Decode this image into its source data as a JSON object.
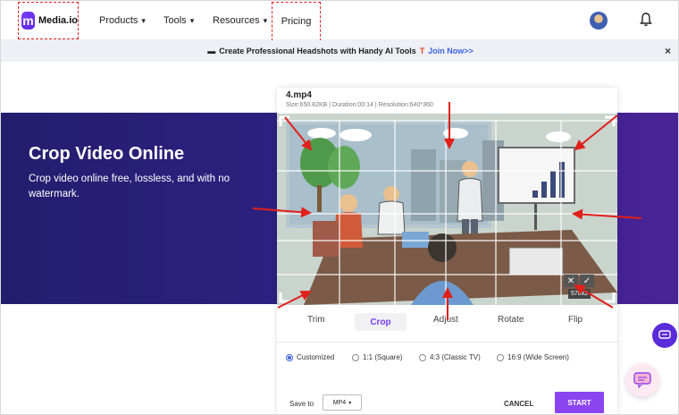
{
  "header": {
    "logo_letter": "m",
    "logo_text": "Media.io",
    "nav": {
      "products": "Products",
      "tools": "Tools",
      "resources": "Resources",
      "pricing": "Pricing"
    }
  },
  "promo": {
    "text": "Create Professional Headshots with Handy AI Tools",
    "join": "Join Now>>",
    "close": "×"
  },
  "hero": {
    "title": "Crop Video Online",
    "subtitle": "Crop video online free, lossless, and with no watermark."
  },
  "editor": {
    "file_name": "4.mp4",
    "file_meta": "Size:650.82KB | Duration:00:14 | Resolution:640*360",
    "crop_size_readout": "578x2",
    "tabs": {
      "trim": "Trim",
      "crop": "Crop",
      "adjust": "Adjust",
      "rotate": "Rotate",
      "flip": "Flip"
    },
    "options": {
      "customized": "Customized",
      "square": "1:1 (Square)",
      "classic": "4:3 (Classic TV)",
      "wide": "16:9 (Wide Screen)"
    },
    "save_to_label": "Save to",
    "format": "MP4",
    "cancel": "CANCEL",
    "start": "START"
  },
  "colors": {
    "accent": "#8b45f0",
    "hero_bg": "#2e2182",
    "link": "#3c63e0",
    "annotation_red": "#e0201b"
  }
}
